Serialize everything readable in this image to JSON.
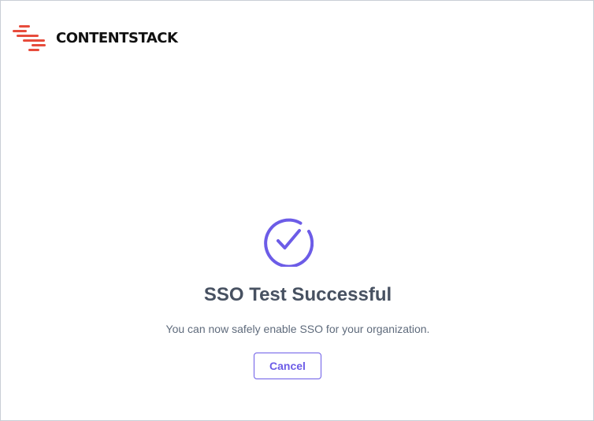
{
  "header": {
    "logo_text": "CONTENTSTACK",
    "logo_icon": "contentstack-logo-icon",
    "logo_color": "#e74c3c"
  },
  "status": {
    "icon": "check-circle-icon",
    "icon_color": "#6c5ce7",
    "title": "SSO Test Successful",
    "message": "You can now safely enable SSO for your organization."
  },
  "actions": {
    "cancel_label": "Cancel",
    "accent_color": "#6c5ce7"
  }
}
